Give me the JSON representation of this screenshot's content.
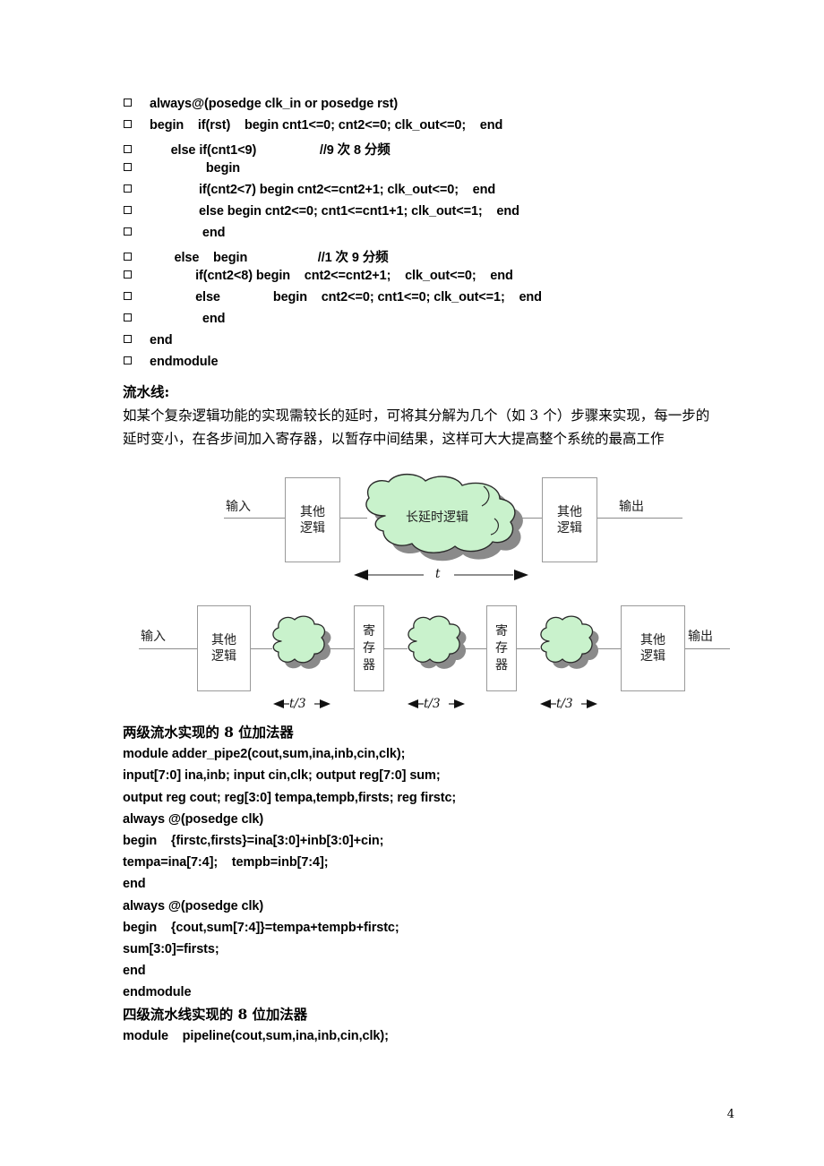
{
  "document": {
    "page_number": "4",
    "colors": {
      "cloud_fill": "#c9f2cc",
      "cloud_stroke": "#2b2b2b",
      "cloud_shadow": "#8a8a8a",
      "box_border": "#9a9a9a",
      "wire": "#8c8c8c",
      "text": "#000000"
    }
  },
  "code_block_1": {
    "bullet_glyph": "square",
    "lines": [
      "always@(posedge clk_in or posedge rst)",
      "begin    if(rst)    begin cnt1<=0; cnt2<=0; clk_out<=0;    end",
      "      else if(cnt1<9)                  //9 次 8 分频",
      "                begin",
      "              if(cnt2<7) begin cnt2<=cnt2+1; clk_out<=0;    end",
      "              else begin cnt2<=0; cnt1<=cnt1+1; clk_out<=1;    end",
      "               end",
      "       else    begin                    //1 次 9 分频",
      "             if(cnt2<8) begin    cnt2<=cnt2+1;    clk_out<=0;    end",
      "             else               begin    cnt2<=0; cnt1<=0; clk_out<=1;    end",
      "               end",
      "end",
      "endmodule"
    ]
  },
  "paragraphs": {
    "heading": "流水线:",
    "body": "如某个复杂逻辑功能的实现需较长的延时，可将其分解为几个（如 3 个）步骤来实现，每一步的延时变小，在各步间加入寄存器，以暂存中间结果，这样可大大提高整个系统的最高工作"
  },
  "figure_1": {
    "caption_hidden": "",
    "input_label": "输入",
    "output_label": "输出",
    "left_box": "其他\n逻辑",
    "left_box_lines": [
      "其他",
      "逻辑"
    ],
    "right_box_lines": [
      "其他",
      "逻辑"
    ],
    "cloud_label": "长延时逻辑",
    "time_label": "t"
  },
  "figure_2": {
    "input_label": "输入",
    "output_label": "输出",
    "left_box_lines": [
      "其他",
      "逻辑"
    ],
    "right_box_lines": [
      "其他",
      "逻辑"
    ],
    "register_box_1": [
      "寄",
      "存",
      "器"
    ],
    "register_box_2": [
      "寄",
      "存",
      "器"
    ],
    "time_labels": [
      "t/3",
      "t/3",
      "t/3"
    ]
  },
  "code_block_2": {
    "title_1": "两级流水实现的 8 位加法器",
    "lines_1": [
      "module adder_pipe2(cout,sum,ina,inb,cin,clk);",
      "input[7:0] ina,inb; input cin,clk; output reg[7:0] sum;",
      "output reg cout; reg[3:0] tempa,tempb,firsts; reg firstc;",
      "always @(posedge clk)",
      "begin    {firstc,firsts}=ina[3:0]+inb[3:0]+cin;",
      "tempa=ina[7:4];    tempb=inb[7:4];",
      "end",
      "always @(posedge clk)",
      "begin    {cout,sum[7:4]}=tempa+tempb+firstc;",
      "sum[3:0]=firsts;",
      "end",
      "endmodule"
    ],
    "title_2": "四级流水线实现的 8 位加法器",
    "lines_2": [
      "module    pipeline(cout,sum,ina,inb,cin,clk);"
    ]
  }
}
